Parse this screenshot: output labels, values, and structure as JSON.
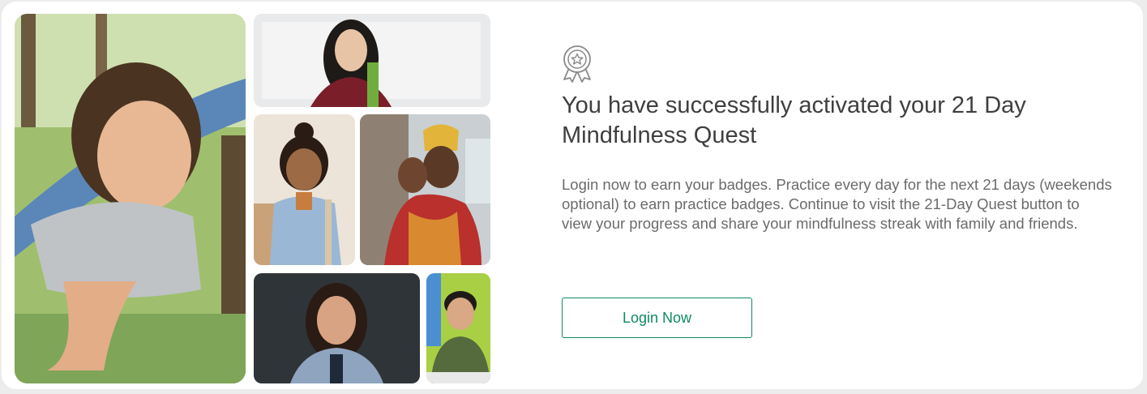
{
  "hero": {
    "title": "You have successfully activated your 21 Day Mindfulness Quest",
    "description": "Login now to earn your badges. Practice every day for the next 21 days (weekends optional) to earn practice badges. Continue to visit the 21-Day Quest button to view your progress and share your mindfulness streak with family and friends.",
    "login_button_label": "Login Now"
  },
  "icons": {
    "badge": "award-ribbon-icon"
  },
  "colors": {
    "accent": "#0f8a5f",
    "title": "#3f3f3f",
    "body_text": "#6b6b6b",
    "card_background": "#ffffff",
    "page_background": "#ececec"
  }
}
